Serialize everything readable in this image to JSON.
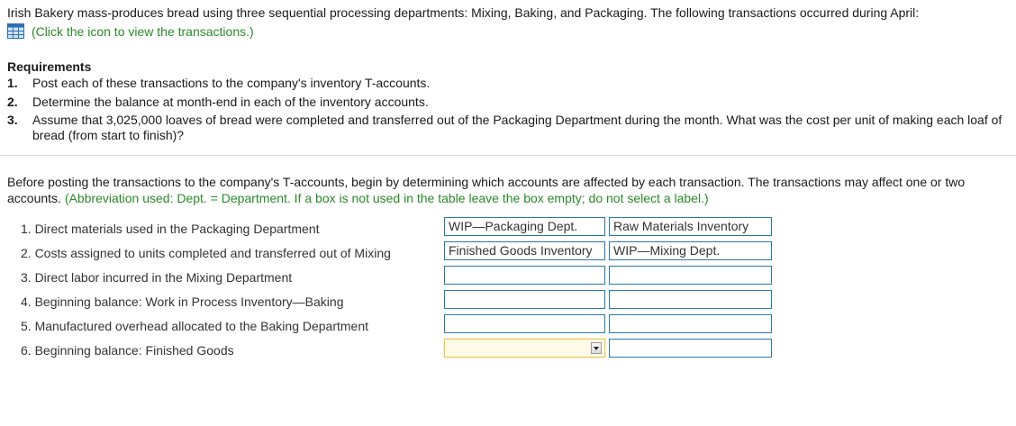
{
  "intro_text": "Irish Bakery mass-produces bread using three sequential processing departments: Mixing, Baking, and Packaging. The following transactions occurred during April:",
  "transactions_link": "(Click the icon to view the transactions.)",
  "requirements": {
    "title": "Requirements",
    "items": [
      {
        "num": "1.",
        "text": "Post each of these transactions to the company's inventory T-accounts."
      },
      {
        "num": "2.",
        "text": "Determine the balance at month-end in each of the inventory accounts."
      },
      {
        "num": "3.",
        "text": "Assume that 3,025,000 loaves of bread were completed and transferred out of the Packaging Department during the month. What was the cost per unit of making each loaf of bread (from start to finish)?"
      }
    ]
  },
  "instructions": {
    "text": "Before posting the transactions to the company's T-accounts, begin by determining which accounts are affected by each transaction. The transactions may affect one or two accounts.",
    "note": "(Abbreviation used: Dept. = Department. If a box is not used in the table leave the box empty; do not select a label.)"
  },
  "rows": [
    {
      "label": "1. Direct materials used in the Packaging Department",
      "acct1": "WIP—Packaging Dept.",
      "acct2": "Raw Materials Inventory"
    },
    {
      "label": "2. Costs assigned to units completed and transferred out of Mixing",
      "acct1": "Finished Goods Inventory",
      "acct2": "WIP—Mixing Dept."
    },
    {
      "label": "3. Direct labor incurred in the Mixing Department",
      "acct1": "",
      "acct2": ""
    },
    {
      "label": "4. Beginning balance: Work in Process Inventory—Baking",
      "acct1": "",
      "acct2": ""
    },
    {
      "label": "5. Manufactured overhead allocated to the Baking Department",
      "acct1": "",
      "acct2": ""
    },
    {
      "label": "6. Beginning balance: Finished Goods",
      "acct1": "",
      "acct2": ""
    }
  ],
  "colors": {
    "link_green": "#2a8a2a",
    "box_border": "#2a7aa8",
    "active_select": "#e8c75a"
  },
  "icons": {
    "transactions": "table-icon",
    "dropdown": "chevron-down-icon"
  }
}
